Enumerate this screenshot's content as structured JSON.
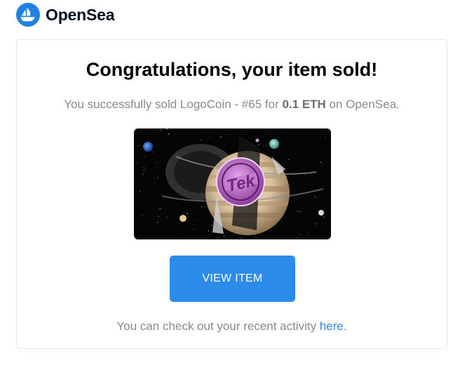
{
  "brand": {
    "name": "OpenSea",
    "logo_icon": "opensea-boat-icon",
    "logo_color": "#2081e2"
  },
  "email": {
    "headline": "Congratulations, your item sold!",
    "summary": {
      "prefix": "You successfully sold LogoCoin - #65 for ",
      "price": "0.1 ETH",
      "suffix": " on OpenSea."
    },
    "item_image_icon": "nft-artwork-tek-coin-planets",
    "button_label": "VIEW ITEM",
    "button_color": "#2c8be8",
    "footer": {
      "prefix": "You can check out your recent activity ",
      "link_text": "here",
      "suffix": "."
    }
  }
}
